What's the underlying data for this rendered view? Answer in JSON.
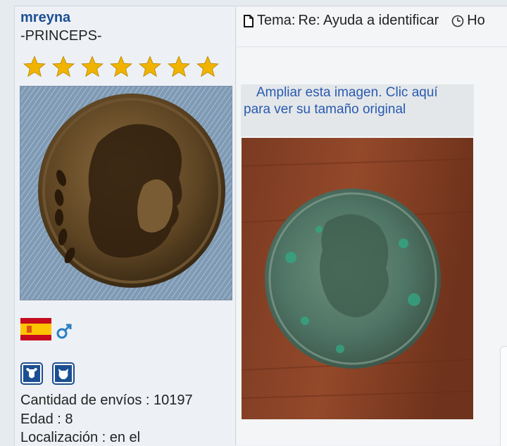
{
  "user": {
    "name": "mreyna",
    "rank": "-PRINCEPS-",
    "star_count": 7,
    "info": [
      {
        "label": "Cantidad de envíos : 10197"
      },
      {
        "label": "Edad : 8"
      },
      {
        "label": "Localización : en el"
      }
    ]
  },
  "post": {
    "topic_prefix": "Tema:",
    "topic_title": "Re: Ayuda a identificar",
    "date_prefix": "Ho",
    "enlarge_line1": "Ampliar esta imagen. Clic aquí",
    "enlarge_line2": "para ver su tamaño original"
  },
  "icons": {
    "star": "star-icon",
    "flag": "spain-flag-icon",
    "gender": "male-icon",
    "zodiac1": "taurus-icon",
    "zodiac2": "ox-icon",
    "topic": "document-icon",
    "time": "clock-icon"
  },
  "colors": {
    "username": "#1d4f93",
    "link": "#2a5ab0",
    "star": "#f0b400"
  }
}
